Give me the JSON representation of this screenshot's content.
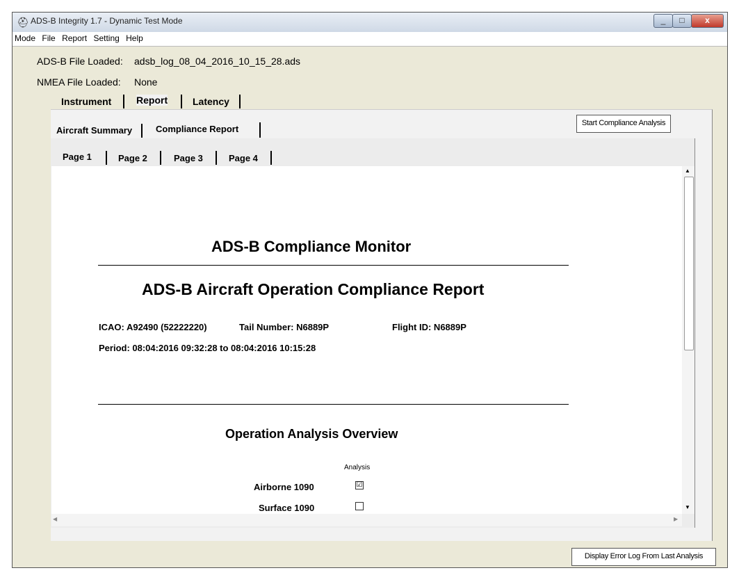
{
  "window": {
    "title": "ADS-B Integrity 1.7 - Dynamic Test Mode",
    "min": "_",
    "max": "□",
    "close": "x"
  },
  "menu": [
    "Mode",
    "File",
    "Report",
    "Setting",
    "Help"
  ],
  "files": {
    "adsb_label": "ADS-B File Loaded:",
    "adsb_value": "adsb_log_08_04_2016_10_15_28.ads",
    "nmea_label": "NMEA File Loaded:",
    "nmea_value": "None"
  },
  "main_tabs": {
    "instrument": "Instrument",
    "report": "Report",
    "latency": "Latency",
    "active": "Report"
  },
  "sub_tabs": {
    "summary": "Aircraft Summary",
    "compliance": "Compliance Report",
    "active": "Compliance Report"
  },
  "page_tabs": {
    "p1": "Page 1",
    "p2": "Page 2",
    "p3": "Page 3",
    "p4": "Page 4",
    "active": "Page 1"
  },
  "buttons": {
    "start": "Start Compliance Analysis",
    "error_log": "Display Error Log From Last Analysis"
  },
  "report": {
    "monitor_title": "ADS-B Compliance Monitor",
    "report_title": "ADS-B Aircraft Operation Compliance Report",
    "icao": "ICAO:  A92490 (52222220)",
    "tail": "Tail Number:  N6889P",
    "flight": "Flight ID:  N6889P",
    "period": "Period:  08:04:2016 09:32:28 to 08:04:2016 10:15:28",
    "overview_title": "Operation Analysis Overview",
    "analysis_header": "Analysis",
    "rows": [
      {
        "label": "Airborne 1090",
        "checked": "☑"
      },
      {
        "label": "Surface 1090",
        "checked": ""
      }
    ]
  }
}
